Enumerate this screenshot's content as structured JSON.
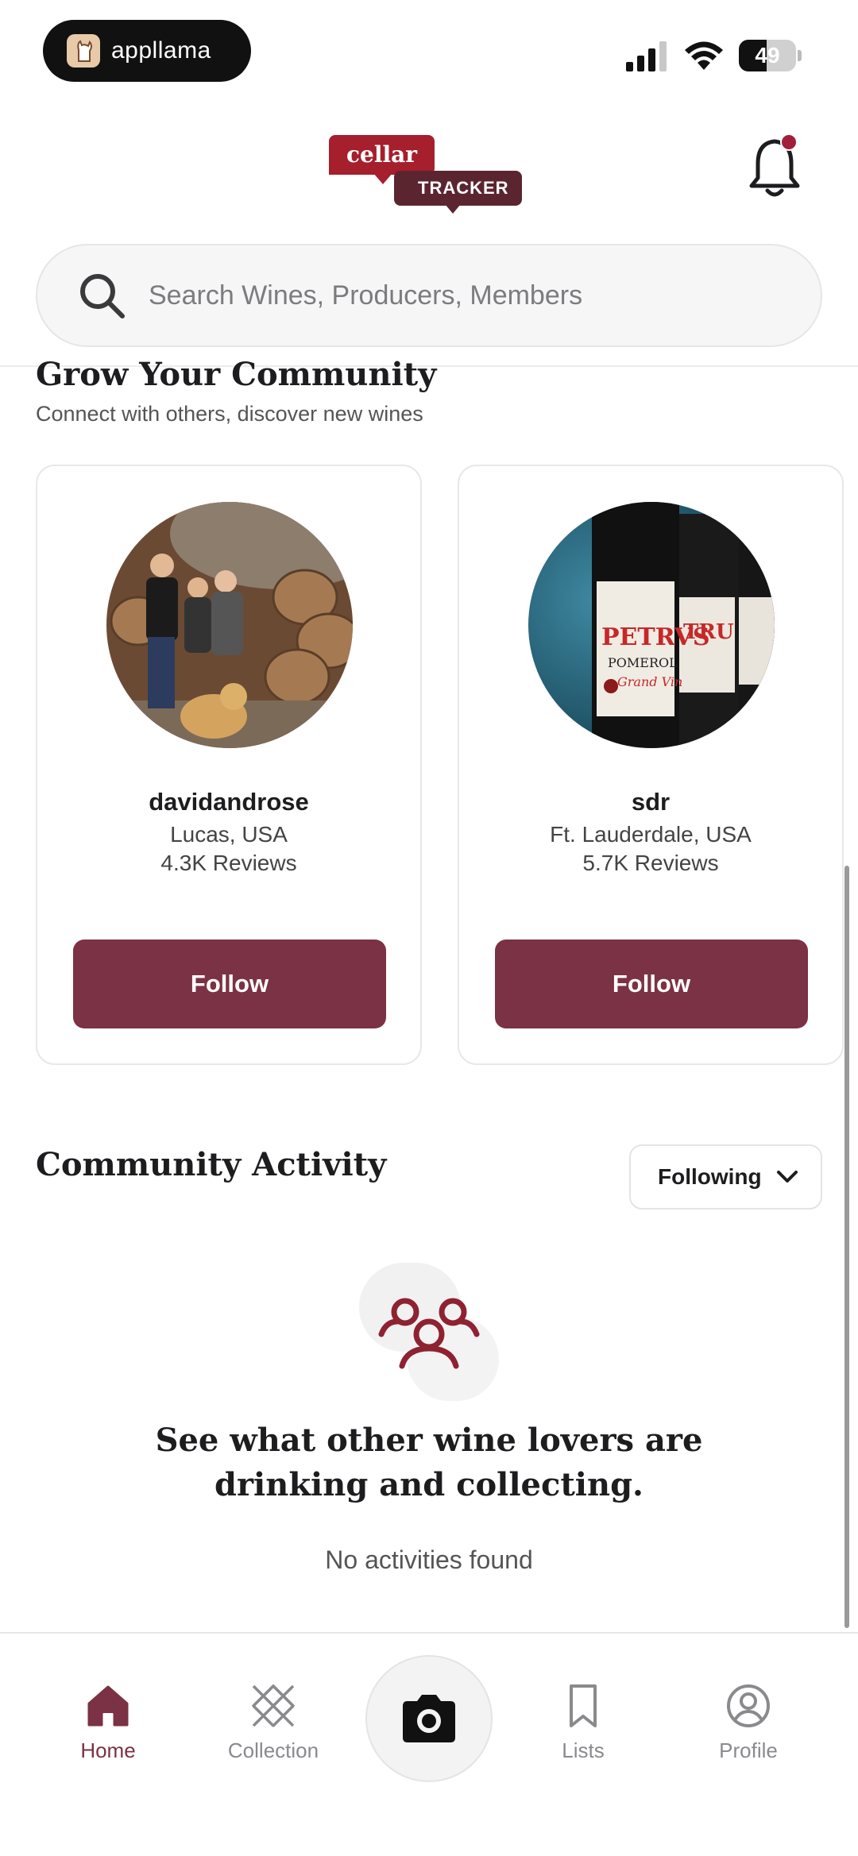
{
  "status_bar": {
    "recorder_app": "appllama",
    "battery_level": "49"
  },
  "colors": {
    "brand": "#7b3244",
    "logo_red": "#a51f2d",
    "logo_dark": "#5b2530"
  },
  "header": {
    "logo_top": "cellar",
    "logo_bottom": "TRACKER",
    "notification_icon": "bell-icon"
  },
  "search": {
    "placeholder": "Search Wines, Producers, Members"
  },
  "grow": {
    "title": "Grow Your Community",
    "subtitle": "Connect with others, discover new wines",
    "members": [
      {
        "name": "davidandrose",
        "location": "Lucas, USA",
        "reviews": "4.3K Reviews",
        "button": "Follow"
      },
      {
        "name": "sdr",
        "location": "Ft. Lauderdale, USA",
        "reviews": "5.7K Reviews",
        "button": "Follow"
      }
    ]
  },
  "activity": {
    "title": "Community Activity",
    "filter": "Following",
    "empty_heading": "See what other wine lovers are drinking and collecting.",
    "empty_message": "No activities found"
  },
  "nav": {
    "home": "Home",
    "collection": "Collection",
    "lists": "Lists",
    "profile": "Profile",
    "active": "home"
  }
}
